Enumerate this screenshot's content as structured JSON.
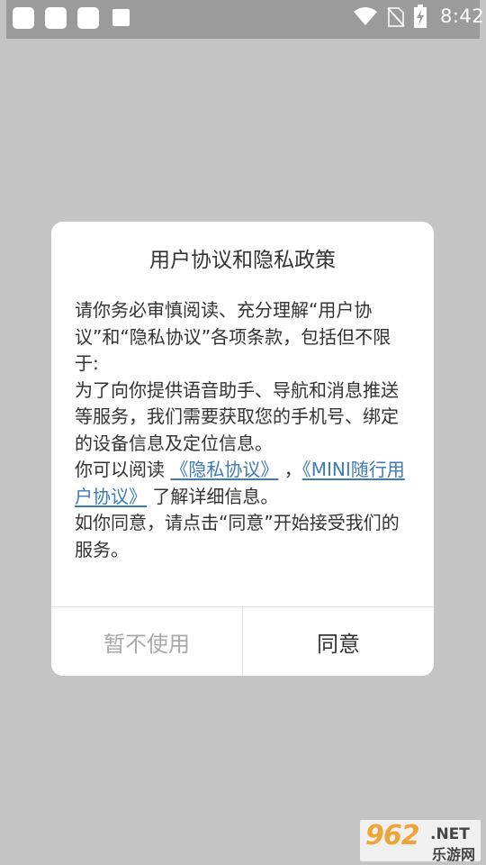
{
  "status_bar": {
    "time": "8:42",
    "icons": [
      "notification-app-icon",
      "notification-app-icon",
      "notification-app-icon",
      "notification-app-icon",
      "wifi-icon",
      "no-sim-icon",
      "battery-charging-icon"
    ]
  },
  "dialog": {
    "title": "用户协议和隐私政策",
    "body_intro": "请你务必审慎阅读、充分理解“用户协议”和“隐私协议”各项条款，包括但不限于:",
    "body_detail": "为了向你提供语音助手、导航和消息推送等服务，我们需要获取您的手机号、绑定的设备信息及定位信息。",
    "body_read_prefix": "你可以阅读",
    "privacy_link": "《隐私协议》",
    "separator": "，",
    "user_agreement_link": "《MINI随行用户协议》",
    "body_read_suffix": "了解详细信息。",
    "body_consent": "如你同意，请点击“同意”开始接受我们的服务。",
    "decline_label": "暂不使用",
    "agree_label": "同意"
  },
  "watermark": {
    "main": "962",
    "net": ".NET",
    "sub": "乐游网"
  },
  "colors": {
    "link": "#3d7bb5",
    "overlay": "#c4c4c4",
    "status_bar": "#9b9b9b",
    "text": "#333333",
    "decline_text": "#a9a9a9"
  }
}
